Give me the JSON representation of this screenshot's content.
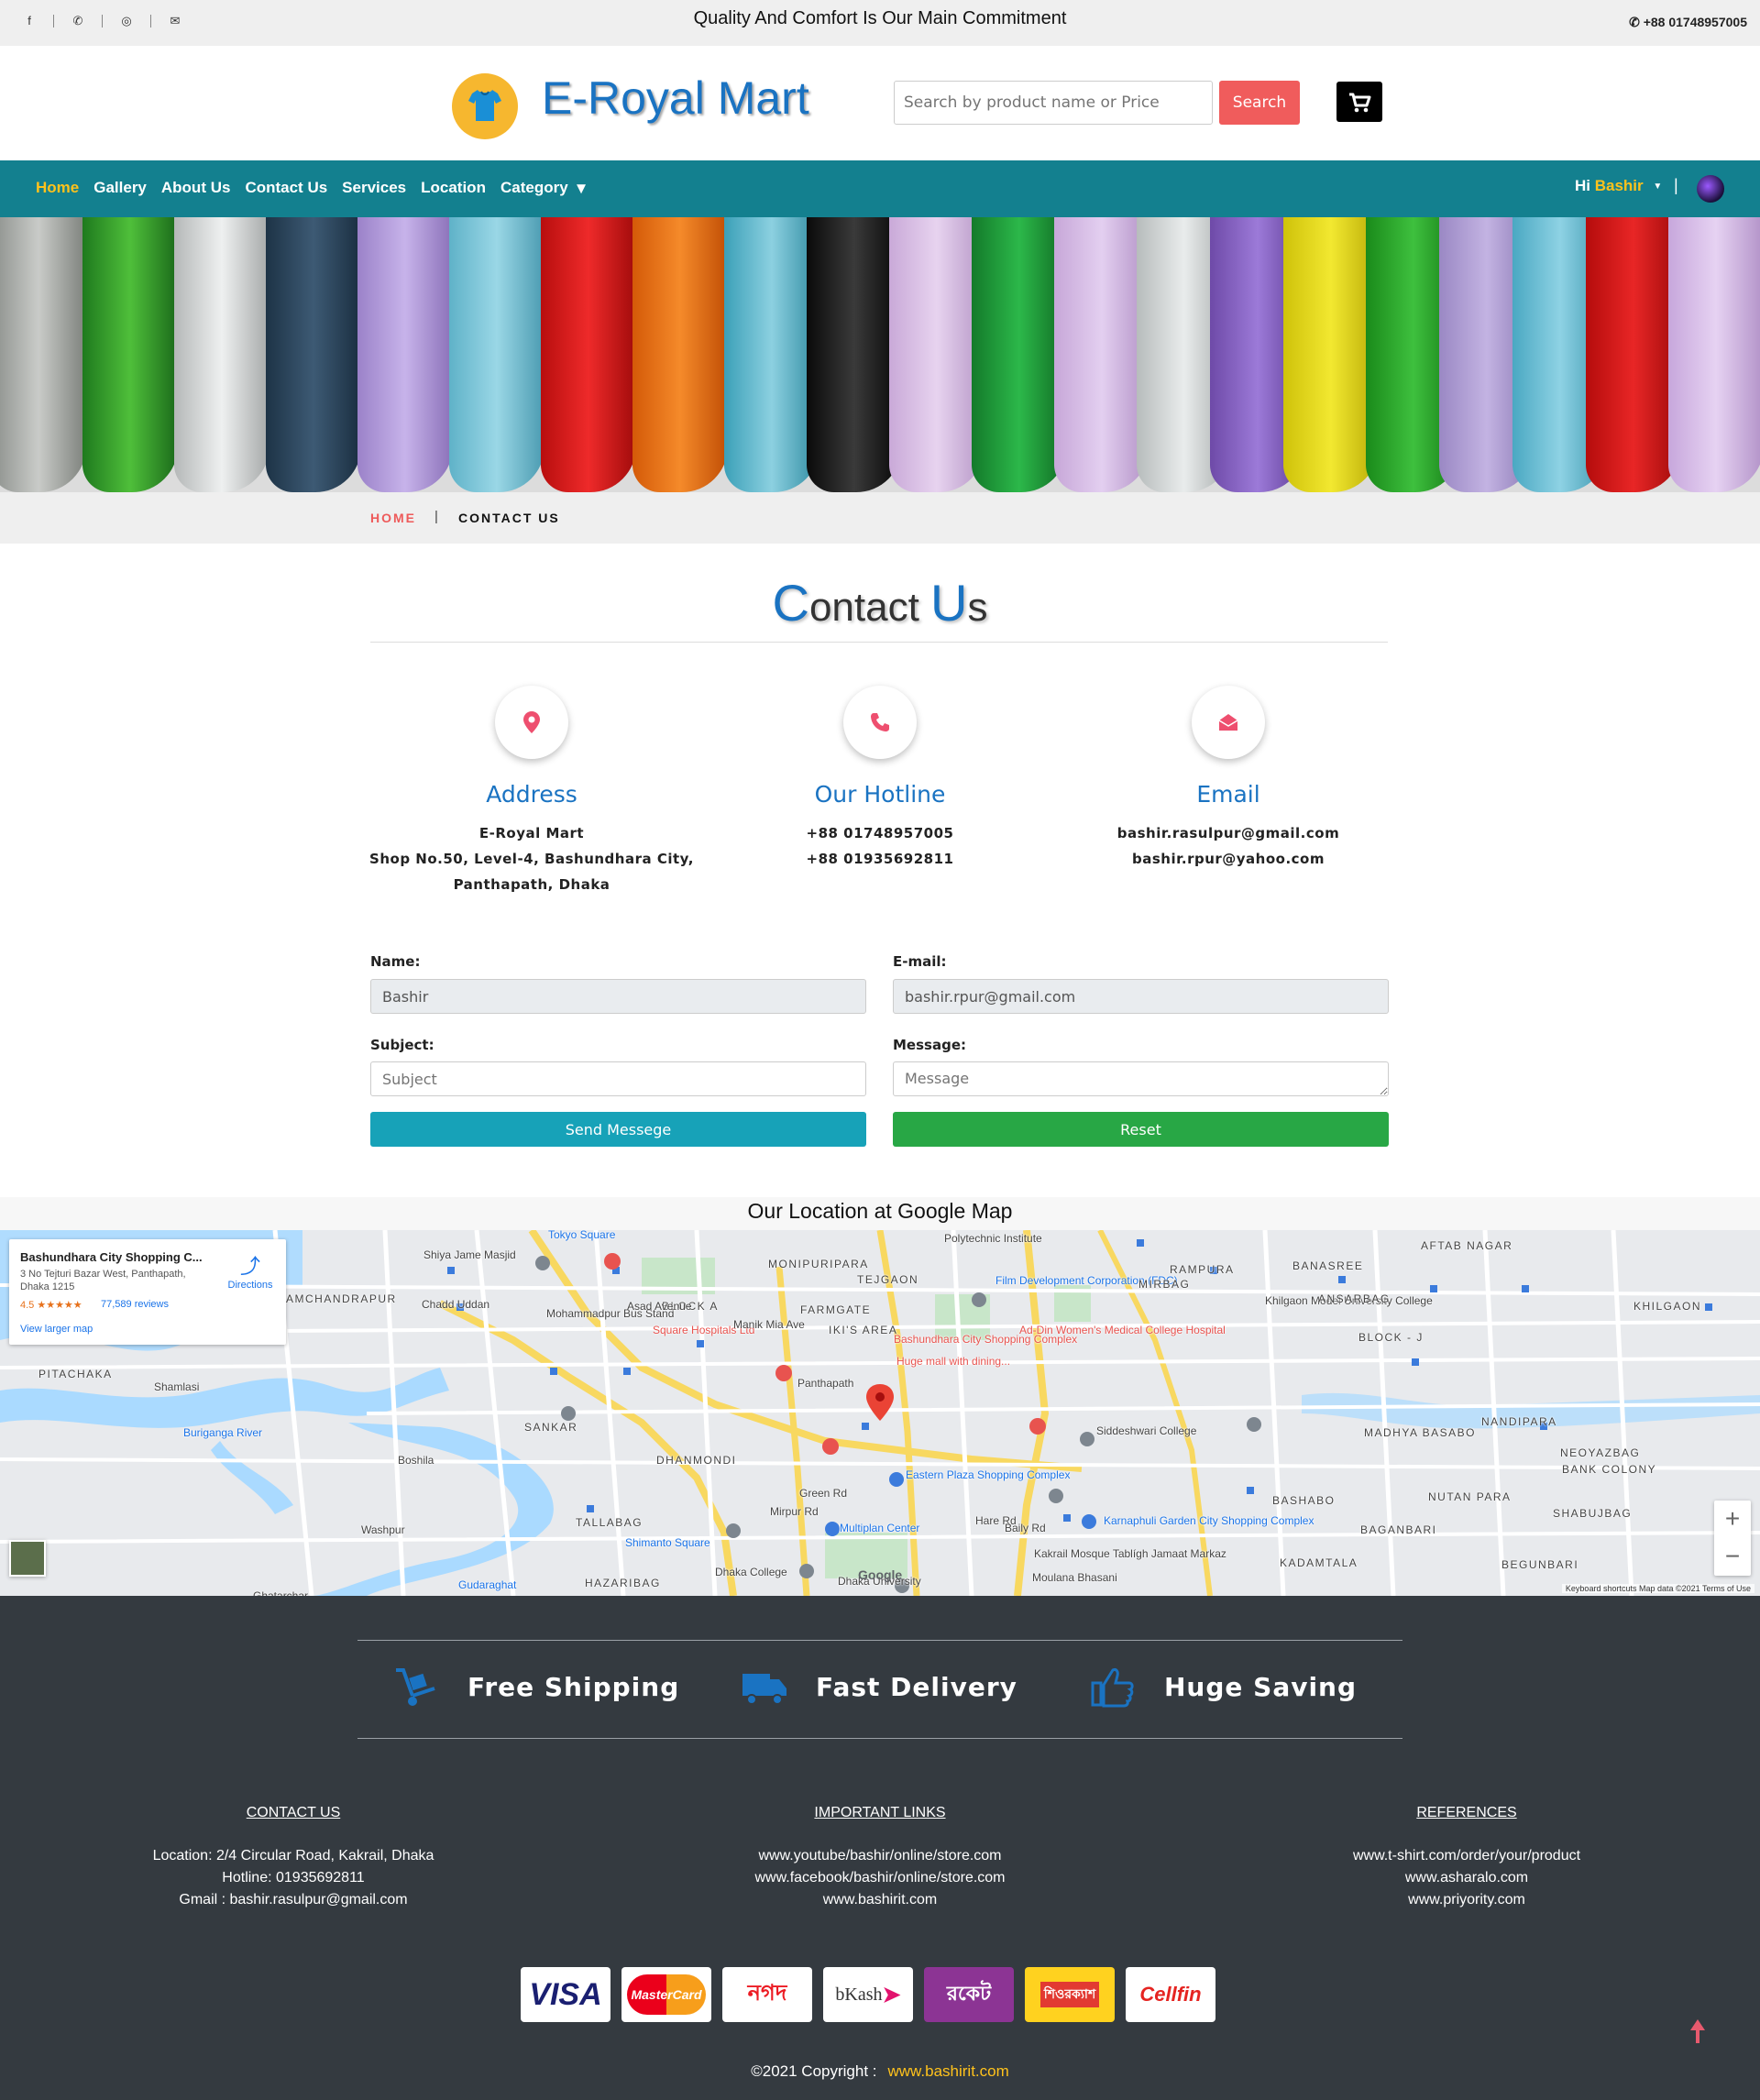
{
  "topbar": {
    "tagline": "Quality And Comfort Is Our Main Commitment",
    "phone": "+88 01748957005",
    "social_icons": [
      "facebook-icon",
      "whatsapp-icon",
      "instagram-icon",
      "email-icon"
    ]
  },
  "header": {
    "brand": "E-Royal Mart",
    "search_placeholder": "Search by product name or Price",
    "search_button": "Search",
    "cart_icon": "cart-icon",
    "brand_color": "#1a73c2",
    "logo_color": "#f6b72f"
  },
  "nav": {
    "items": [
      {
        "label": "Home",
        "active": true
      },
      {
        "label": "Gallery"
      },
      {
        "label": "About Us"
      },
      {
        "label": "Contact Us"
      },
      {
        "label": "Services"
      },
      {
        "label": "Location"
      },
      {
        "label": "Category",
        "dropdown": true
      }
    ],
    "greeting": "Hi",
    "username": "Bashir",
    "separator": "|",
    "bg_color": "#13808f",
    "active_color": "#ffc21c"
  },
  "breadcrumb": {
    "home": "HOME",
    "separator": "|",
    "current": "CONTACT US"
  },
  "contact": {
    "title_first_cap": "C",
    "title_rest_1": "ontact ",
    "title_second_cap": "U",
    "title_rest_2": "s",
    "address": {
      "title": "Address",
      "icon": "map-marker-icon",
      "lines": [
        "E-Royal Mart",
        "Shop No.50, Level-4, Bashundhara City,",
        "Panthapath, Dhaka"
      ]
    },
    "hotline": {
      "title": "Our Hotline",
      "icon": "phone-icon",
      "lines": [
        "+88 01748957005",
        "+88 01935692811"
      ]
    },
    "email": {
      "title": "Email",
      "icon": "envelope-open-icon",
      "lines": [
        "bashir.rasulpur@gmail.com",
        "bashir.rpur@yahoo.com"
      ]
    }
  },
  "form": {
    "name_label": "Name:",
    "name_value": "Bashir",
    "email_label": "E-mail:",
    "email_value": "bashir.rpur@gmail.com",
    "subject_label": "Subject:",
    "subject_placeholder": "Subject",
    "message_label": "Message:",
    "message_placeholder": "Message",
    "send_button": "Send Messege",
    "reset_button": "Reset",
    "send_color": "#17a2b8",
    "reset_color": "#28a745"
  },
  "map": {
    "title": "Our Location at Google Map",
    "card_title": "Bashundhara City Shopping C...",
    "card_address": "3 No Tejturi Bazar West, Panthapath, Dhaka 1215",
    "rating": "4.5 ★★★★★",
    "reviews": "77,589 reviews",
    "larger_link": "View larger map",
    "directions": "Directions",
    "zoom_in": "+",
    "zoom_out": "−",
    "footer": "Keyboard shortcuts    Map data ©2021    Terms of Use",
    "google_logo": "Google",
    "labels": [
      {
        "text": "Tokyo Square"
      },
      {
        "text": "Shiya Jame Masjid"
      },
      {
        "text": "MONIPURIPARA"
      },
      {
        "text": "TEJGAON"
      },
      {
        "text": "Polytechnic Institute"
      },
      {
        "text": "Film Development Corporation (FDC)"
      },
      {
        "text": "MIRBAG"
      },
      {
        "text": "RAMPURA"
      },
      {
        "text": "AFTAB NAGAR"
      },
      {
        "text": "BANASREE"
      },
      {
        "text": "AMCHANDRAPUR"
      },
      {
        "text": "Chadd Uddan"
      },
      {
        "text": "Mohammadpur Bus Stand"
      },
      {
        "text": "BLOCK A"
      },
      {
        "text": "FARMGATE"
      },
      {
        "text": "Khilgaon Model University College"
      },
      {
        "text": "ANSARBAG"
      },
      {
        "text": "KHILGAON"
      },
      {
        "text": "Square Hospitals Ltd"
      },
      {
        "text": "IKI'S AREA"
      },
      {
        "text": "Bashundhara City Shopping Complex"
      },
      {
        "text": "Huge mall with dining..."
      },
      {
        "text": "Ad-Din Women's Medical College Hospital"
      },
      {
        "text": "BLOCK - J"
      },
      {
        "text": "Shamlasi"
      },
      {
        "text": "PITACHAKA"
      },
      {
        "text": "SANKAR"
      },
      {
        "text": "Siddeshwari College"
      },
      {
        "text": "MADHYA BASABO"
      },
      {
        "text": "NANDIPARA"
      },
      {
        "text": "NEOYAZBAG"
      },
      {
        "text": "BANK COLONY"
      },
      {
        "text": "Boshila"
      },
      {
        "text": "DHANMONDI"
      },
      {
        "text": "Eastern Plaza Shopping Complex"
      },
      {
        "text": "BASHABO"
      },
      {
        "text": "NUTAN PARA"
      },
      {
        "text": "SHABUJBAG"
      },
      {
        "text": "TALLABAG"
      },
      {
        "text": "Washpur"
      },
      {
        "text": "Multiplan Center"
      },
      {
        "text": "Karnaphuli Garden City Shopping Complex"
      },
      {
        "text": "BAGANBARI"
      },
      {
        "text": "Shimanto Square"
      },
      {
        "text": "Kakrail Mosque Tablígh Jamaat Markaz"
      },
      {
        "text": "KADAMTALA"
      },
      {
        "text": "BEGUNBARI"
      },
      {
        "text": "Dhaka College"
      },
      {
        "text": "Dhaka University"
      },
      {
        "text": "HAZARIBAG"
      },
      {
        "text": "Gudaraghat"
      },
      {
        "text": "Ghatarchar"
      },
      {
        "text": "Mirpur Rd"
      },
      {
        "text": "Green Rd"
      },
      {
        "text": "Hare Rd"
      },
      {
        "text": "Baily Rd"
      },
      {
        "text": "Panthapath"
      },
      {
        "text": "Manik Mia Ave"
      },
      {
        "text": "Asad Avenue"
      },
      {
        "text": "Buriganga River"
      },
      {
        "text": "Moulana Bhasani"
      }
    ]
  },
  "features": [
    {
      "label": "Free Shipping",
      "icon": "dolly-icon"
    },
    {
      "label": "Fast Delivery",
      "icon": "truck-icon"
    },
    {
      "label": "Huge Saving",
      "icon": "thumbs-up-icon"
    }
  ],
  "footer": {
    "contact": {
      "title": "CONTACT US",
      "lines": [
        "Location: 2/4 Circular Road, Kakrail, Dhaka",
        "Hotline: 01935692811",
        "Gmail : bashir.rasulpur@gmail.com"
      ]
    },
    "links": {
      "title": "IMPORTANT LINKS",
      "lines": [
        "www.youtube/bashir/online/store.com",
        "www.facebook/bashir/online/store.com",
        "www.bashirit.com"
      ]
    },
    "references": {
      "title": "REFERENCES",
      "lines": [
        "www.t-shirt.com/order/your/product",
        "www.asharalo.com",
        "www.priyority.com"
      ]
    },
    "payments": [
      "VISA",
      "MasterCard",
      "নগদ",
      "bKash",
      "রকেট",
      "শিওরক্যাশ",
      "Cellfin"
    ],
    "copyright": "©2021 Copyright :",
    "copyright_link": "www.bashirit.com",
    "bg_color": "#343a40"
  }
}
